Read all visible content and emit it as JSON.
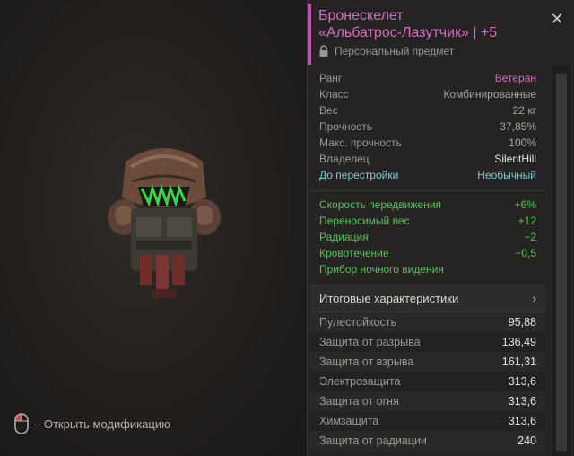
{
  "item": {
    "title_line1": "Бронескелет",
    "title_line2": "«Альбатрос-Лазутчик» | +5",
    "personal_label": "Персональный предмет"
  },
  "hint": {
    "label": "– Открыть модификацию"
  },
  "info": [
    {
      "label": "Ранг",
      "value": "Ветеран"
    },
    {
      "label": "Класс",
      "value": "Комбинированные"
    },
    {
      "label": "Вес",
      "value": "22 кг"
    },
    {
      "label": "Прочность",
      "value": "37,85%"
    },
    {
      "label": "Макс. прочность",
      "value": "100%"
    },
    {
      "label": "Владелец",
      "value": "SilentHill"
    },
    {
      "label": "До перестройки",
      "value": "Необычный"
    }
  ],
  "bonuses": [
    {
      "label": "Скорость передвижения",
      "value": "+6%"
    },
    {
      "label": "Переносимый вес",
      "value": "+12"
    },
    {
      "label": "Радиация",
      "value": "−2"
    },
    {
      "label": "Кровотечение",
      "value": "−0,5"
    },
    {
      "label": "Прибор ночного видения",
      "value": ""
    }
  ],
  "totals": {
    "label": "Итоговые характеристики",
    "stats": [
      {
        "label": "Пулестойкость",
        "value": "95,88"
      },
      {
        "label": "Защита от разрыва",
        "value": "136,49"
      },
      {
        "label": "Защита от взрыва",
        "value": "161,31"
      },
      {
        "label": "Электрозащита",
        "value": "313,6"
      },
      {
        "label": "Защита от огня",
        "value": "313,6"
      },
      {
        "label": "Химзащита",
        "value": "313,6"
      },
      {
        "label": "Защита от радиации",
        "value": "240"
      }
    ]
  },
  "colors": {
    "accent": "#c54fb4",
    "rank": "#d36cc4",
    "owner": "#e8e4e0",
    "rebuild_label": "#7fc8d8",
    "rebuild_value": "#7fc8d8",
    "bonus": "#57c15a"
  },
  "icons": {
    "close": "close-icon",
    "lock": "lock-icon",
    "mouse": "mouse-icon",
    "chevron": "chevron-right-icon"
  }
}
